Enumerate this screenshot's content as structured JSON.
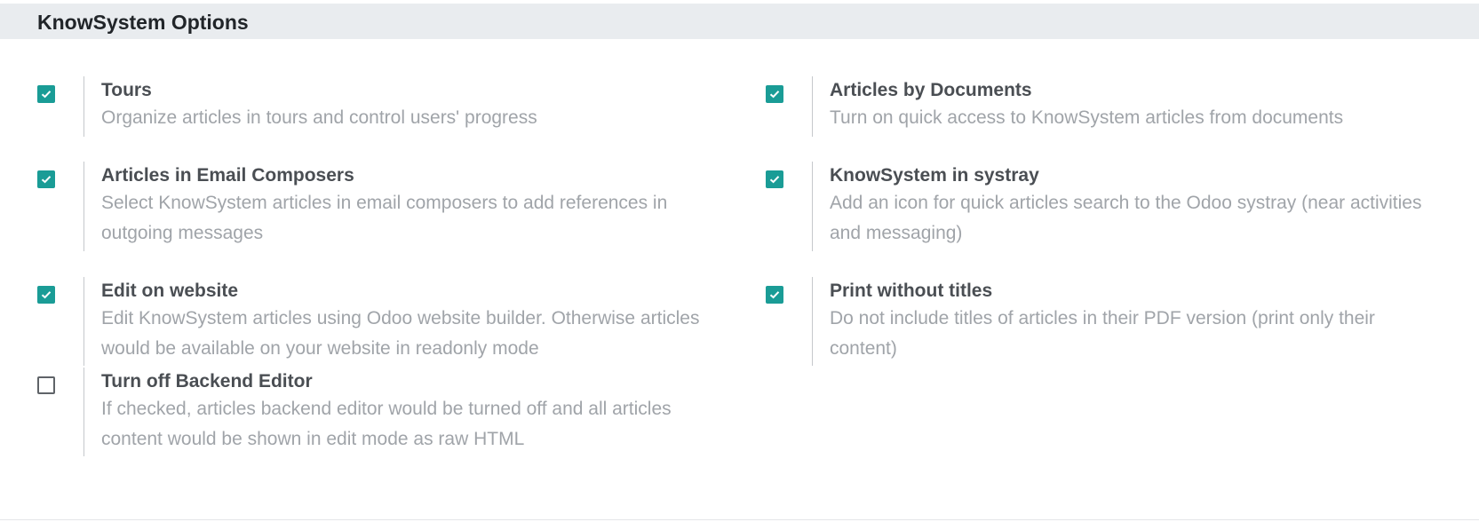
{
  "section": {
    "title": "KnowSystem Options"
  },
  "settings": [
    {
      "label": "Tours",
      "description": "Organize articles in tours and control users' progress",
      "checked": true
    },
    {
      "label": "Articles by Documents",
      "description": "Turn on quick access to KnowSystem articles from documents",
      "checked": true
    },
    {
      "label": "Articles in Email Composers",
      "description": "Select KnowSystem articles in email composers to add references in outgoing messages",
      "checked": true
    },
    {
      "label": "KnowSystem in systray",
      "description": "Add an icon for quick articles search to the Odoo systray (near activities and messaging)",
      "checked": true
    },
    {
      "label": "Edit on website",
      "description": "Edit KnowSystem articles using Odoo website builder. Otherwise articles would be available on your website in readonly mode",
      "checked": true
    },
    {
      "label": "Print without titles",
      "description": "Do not include titles of articles in their PDF version (print only their content)",
      "checked": true
    },
    {
      "label": "Turn off Backend Editor",
      "description": "If checked, articles backend editor would be turned off and all articles content would be shown in edit mode as raw HTML",
      "checked": false
    }
  ],
  "colors": {
    "checkbox_accent": "#1a9c96",
    "header_background": "#e9ecef"
  }
}
